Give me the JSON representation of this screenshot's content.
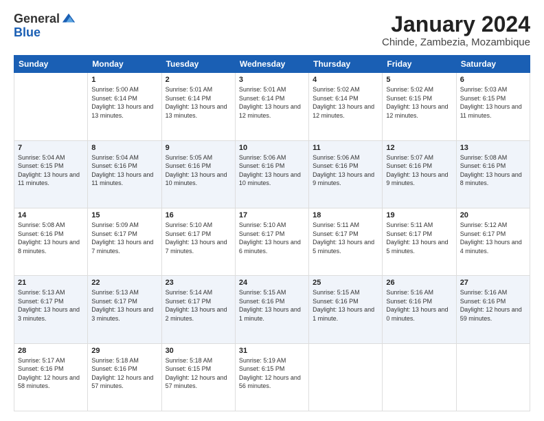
{
  "logo": {
    "general": "General",
    "blue": "Blue"
  },
  "header": {
    "month": "January 2024",
    "location": "Chinde, Zambezia, Mozambique"
  },
  "weekdays": [
    "Sunday",
    "Monday",
    "Tuesday",
    "Wednesday",
    "Thursday",
    "Friday",
    "Saturday"
  ],
  "weeks": [
    [
      {
        "num": "",
        "empty": true
      },
      {
        "num": "1",
        "sunrise": "5:00 AM",
        "sunset": "6:14 PM",
        "daylight": "13 hours and 13 minutes."
      },
      {
        "num": "2",
        "sunrise": "5:01 AM",
        "sunset": "6:14 PM",
        "daylight": "13 hours and 13 minutes."
      },
      {
        "num": "3",
        "sunrise": "5:01 AM",
        "sunset": "6:14 PM",
        "daylight": "13 hours and 12 minutes."
      },
      {
        "num": "4",
        "sunrise": "5:02 AM",
        "sunset": "6:14 PM",
        "daylight": "13 hours and 12 minutes."
      },
      {
        "num": "5",
        "sunrise": "5:02 AM",
        "sunset": "6:15 PM",
        "daylight": "13 hours and 12 minutes."
      },
      {
        "num": "6",
        "sunrise": "5:03 AM",
        "sunset": "6:15 PM",
        "daylight": "13 hours and 11 minutes."
      }
    ],
    [
      {
        "num": "7",
        "sunrise": "5:04 AM",
        "sunset": "6:15 PM",
        "daylight": "13 hours and 11 minutes."
      },
      {
        "num": "8",
        "sunrise": "5:04 AM",
        "sunset": "6:16 PM",
        "daylight": "13 hours and 11 minutes."
      },
      {
        "num": "9",
        "sunrise": "5:05 AM",
        "sunset": "6:16 PM",
        "daylight": "13 hours and 10 minutes."
      },
      {
        "num": "10",
        "sunrise": "5:06 AM",
        "sunset": "6:16 PM",
        "daylight": "13 hours and 10 minutes."
      },
      {
        "num": "11",
        "sunrise": "5:06 AM",
        "sunset": "6:16 PM",
        "daylight": "13 hours and 9 minutes."
      },
      {
        "num": "12",
        "sunrise": "5:07 AM",
        "sunset": "6:16 PM",
        "daylight": "13 hours and 9 minutes."
      },
      {
        "num": "13",
        "sunrise": "5:08 AM",
        "sunset": "6:16 PM",
        "daylight": "13 hours and 8 minutes."
      }
    ],
    [
      {
        "num": "14",
        "sunrise": "5:08 AM",
        "sunset": "6:16 PM",
        "daylight": "13 hours and 8 minutes."
      },
      {
        "num": "15",
        "sunrise": "5:09 AM",
        "sunset": "6:17 PM",
        "daylight": "13 hours and 7 minutes."
      },
      {
        "num": "16",
        "sunrise": "5:10 AM",
        "sunset": "6:17 PM",
        "daylight": "13 hours and 7 minutes."
      },
      {
        "num": "17",
        "sunrise": "5:10 AM",
        "sunset": "6:17 PM",
        "daylight": "13 hours and 6 minutes."
      },
      {
        "num": "18",
        "sunrise": "5:11 AM",
        "sunset": "6:17 PM",
        "daylight": "13 hours and 5 minutes."
      },
      {
        "num": "19",
        "sunrise": "5:11 AM",
        "sunset": "6:17 PM",
        "daylight": "13 hours and 5 minutes."
      },
      {
        "num": "20",
        "sunrise": "5:12 AM",
        "sunset": "6:17 PM",
        "daylight": "13 hours and 4 minutes."
      }
    ],
    [
      {
        "num": "21",
        "sunrise": "5:13 AM",
        "sunset": "6:17 PM",
        "daylight": "13 hours and 3 minutes."
      },
      {
        "num": "22",
        "sunrise": "5:13 AM",
        "sunset": "6:17 PM",
        "daylight": "13 hours and 3 minutes."
      },
      {
        "num": "23",
        "sunrise": "5:14 AM",
        "sunset": "6:17 PM",
        "daylight": "13 hours and 2 minutes."
      },
      {
        "num": "24",
        "sunrise": "5:15 AM",
        "sunset": "6:16 PM",
        "daylight": "13 hours and 1 minute."
      },
      {
        "num": "25",
        "sunrise": "5:15 AM",
        "sunset": "6:16 PM",
        "daylight": "13 hours and 1 minute."
      },
      {
        "num": "26",
        "sunrise": "5:16 AM",
        "sunset": "6:16 PM",
        "daylight": "13 hours and 0 minutes."
      },
      {
        "num": "27",
        "sunrise": "5:16 AM",
        "sunset": "6:16 PM",
        "daylight": "12 hours and 59 minutes."
      }
    ],
    [
      {
        "num": "28",
        "sunrise": "5:17 AM",
        "sunset": "6:16 PM",
        "daylight": "12 hours and 58 minutes."
      },
      {
        "num": "29",
        "sunrise": "5:18 AM",
        "sunset": "6:16 PM",
        "daylight": "12 hours and 57 minutes."
      },
      {
        "num": "30",
        "sunrise": "5:18 AM",
        "sunset": "6:15 PM",
        "daylight": "12 hours and 57 minutes."
      },
      {
        "num": "31",
        "sunrise": "5:19 AM",
        "sunset": "6:15 PM",
        "daylight": "12 hours and 56 minutes."
      },
      {
        "num": "",
        "empty": true
      },
      {
        "num": "",
        "empty": true
      },
      {
        "num": "",
        "empty": true
      }
    ]
  ]
}
